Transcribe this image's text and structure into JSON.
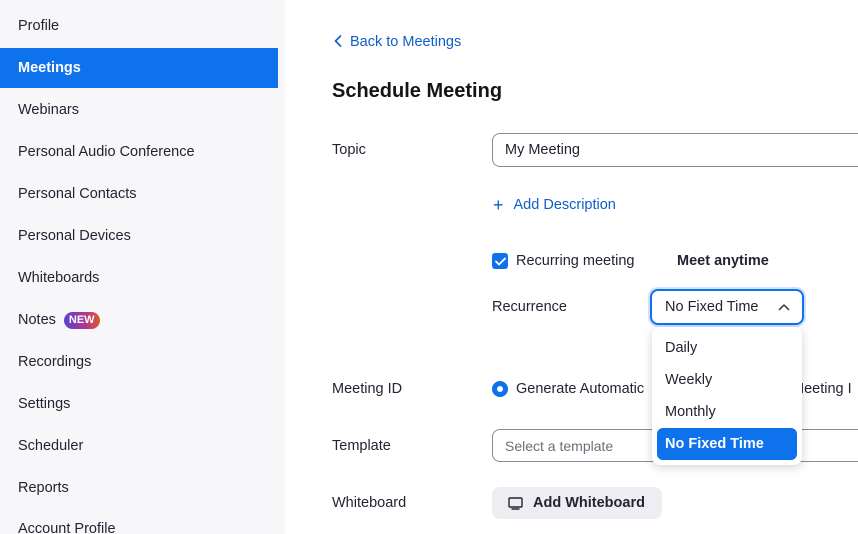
{
  "sidebar": {
    "items": [
      {
        "label": "Profile"
      },
      {
        "label": "Meetings"
      },
      {
        "label": "Webinars"
      },
      {
        "label": "Personal Audio Conference"
      },
      {
        "label": "Personal Contacts"
      },
      {
        "label": "Personal Devices"
      },
      {
        "label": "Whiteboards"
      },
      {
        "label": "Notes",
        "badge": "NEW"
      },
      {
        "label": "Recordings"
      },
      {
        "label": "Settings"
      },
      {
        "label": "Scheduler"
      },
      {
        "label": "Reports"
      },
      {
        "label": "Account Profile"
      }
    ],
    "active": "Meetings"
  },
  "main": {
    "back_link": "Back to Meetings",
    "title": "Schedule Meeting",
    "topic": {
      "label": "Topic",
      "value": "My Meeting"
    },
    "add_description": "Add Description",
    "recurring": {
      "label": "Recurring meeting",
      "checked": true,
      "note": "Meet anytime"
    },
    "recurrence": {
      "label": "Recurrence",
      "selected": "No Fixed Time",
      "options": [
        "Daily",
        "Weekly",
        "Monthly",
        "No Fixed Time"
      ]
    },
    "meeting_id": {
      "label": "Meeting ID",
      "option1": "Generate Automatic",
      "option2_partial": "Meeting I"
    },
    "template": {
      "label": "Template",
      "placeholder": "Select a template"
    },
    "whiteboard": {
      "label": "Whiteboard",
      "button": "Add Whiteboard"
    }
  },
  "colors": {
    "accent": "#0e72ed",
    "link": "#0e5fc7",
    "sidebar_bg": "#f7f7fa"
  }
}
